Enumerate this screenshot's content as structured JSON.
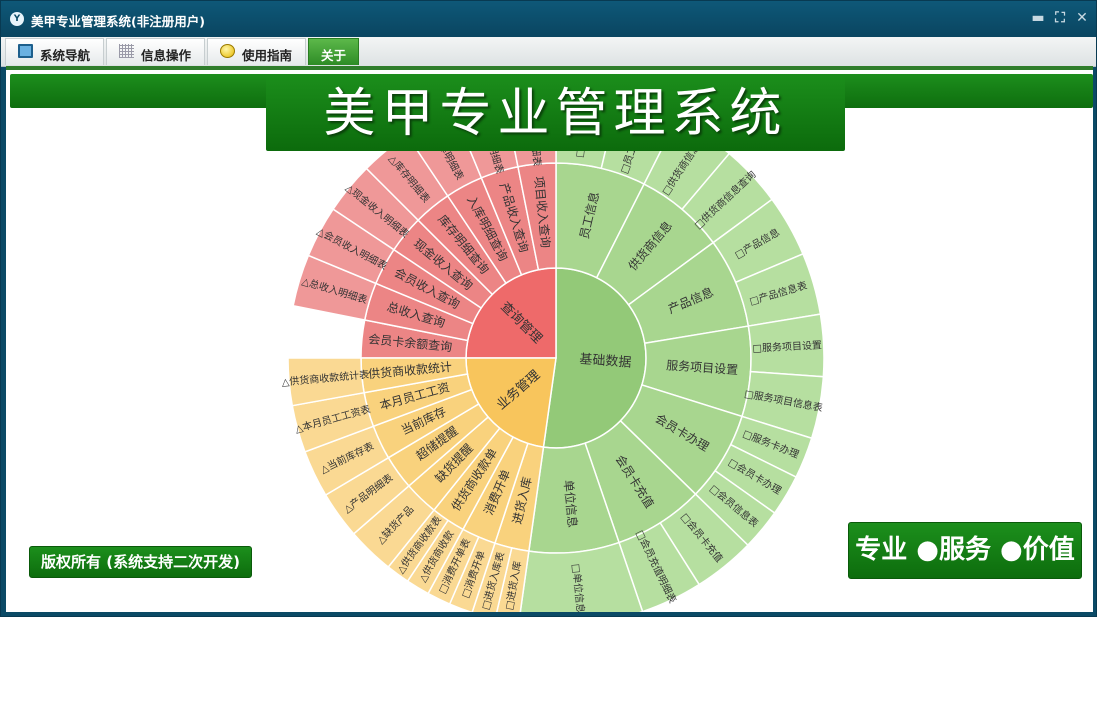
{
  "window": {
    "title": "美甲专业管理系统(非注册用户)",
    "logo": "Y",
    "controls": {
      "minimize": "▬",
      "restore": "⛶",
      "close": "✕"
    }
  },
  "menu": {
    "tabs": [
      {
        "id": "nav",
        "label": "系统导航",
        "icon": "monitor-icon"
      },
      {
        "id": "info",
        "label": "信息操作",
        "icon": "grid-icon"
      },
      {
        "id": "guide",
        "label": "使用指南",
        "icon": "help-icon"
      },
      {
        "id": "about",
        "label": "关于",
        "icon": ""
      }
    ],
    "active": "关于"
  },
  "banner": {
    "title": "美甲专业管理系统"
  },
  "copyright": "版权所有 (系统支持二次开发)",
  "slogan": "专业 ●服务 ●价值",
  "colors": {
    "brand_green": "#138413",
    "titlebar": "#0b4a66",
    "query": "#ee6a6a",
    "basic": "#8fc874",
    "business": "#f8c55c"
  },
  "sunburst": {
    "groups": [
      {
        "name": "基础数据",
        "items": [
          {
            "label": "员工信息",
            "leaves": [
              "□员工信息表",
              "□员工信息查询"
            ]
          },
          {
            "label": "供货商信息",
            "leaves": [
              "□供货商信息表",
              "□供货商信息查询"
            ]
          },
          {
            "label": "产品信息",
            "leaves": [
              "□产品信息",
              "□产品信息表"
            ]
          },
          {
            "label": "服务项目设置",
            "leaves": [
              "□服务项目设置",
              "□服务项目信息表"
            ]
          },
          {
            "label": "会员卡办理",
            "leaves": [
              "□服务卡办理",
              "□会员卡办理",
              "□会员信息表"
            ]
          },
          {
            "label": "会员卡充值",
            "leaves": [
              "□会员卡充值",
              "□会员充值明细表"
            ]
          },
          {
            "label": "单位信息",
            "leaves": [
              "□单位信息"
            ]
          }
        ]
      },
      {
        "name": "查询管理",
        "items": [
          {
            "label": "会员卡余额查询",
            "leaves": []
          },
          {
            "label": "总收入查询",
            "leaves": [
              "△总收入明细表"
            ]
          },
          {
            "label": "会员收入查询",
            "leaves": [
              "△会员收入明细表"
            ]
          },
          {
            "label": "现金收入查询",
            "leaves": [
              "△现金收入明细表"
            ]
          },
          {
            "label": "库存明细查询",
            "leaves": [
              "△库存明细表"
            ]
          },
          {
            "label": "入库明细查询",
            "leaves": [
              "△入库明细表"
            ]
          },
          {
            "label": "产品收入查询",
            "leaves": [
              "△产品收入明细表"
            ]
          },
          {
            "label": "项目收入查询",
            "leaves": [
              "△项目收入明细表"
            ]
          }
        ]
      },
      {
        "name": "业务管理",
        "items": [
          {
            "label": "进货入库",
            "leaves": [
              "□进货入库",
              "□进货入库表"
            ]
          },
          {
            "label": "消费开单",
            "leaves": [
              "□消费开单",
              "□消费开单表"
            ]
          },
          {
            "label": "供货商收款单",
            "leaves": [
              "△供货商收款",
              "△供货商收款表"
            ]
          },
          {
            "label": "缺货提醒",
            "leaves": [
              "△缺货产品"
            ]
          },
          {
            "label": "超储提醒",
            "leaves": [
              "△产品明细表"
            ]
          },
          {
            "label": "当前库存",
            "leaves": [
              "△当前库存表"
            ]
          },
          {
            "label": "本月员工工资",
            "leaves": [
              "△本月员工工资表"
            ]
          },
          {
            "label": "供货商收款统计",
            "leaves": [
              "△供货商收款统计表"
            ]
          }
        ]
      }
    ]
  }
}
